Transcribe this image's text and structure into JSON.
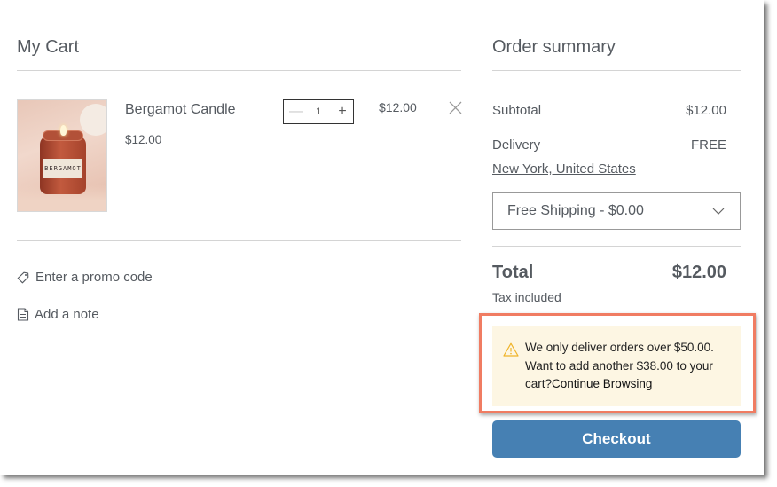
{
  "cart": {
    "title": "My Cart",
    "items": [
      {
        "name": "Bergamot Candle",
        "unit_price": "$12.00",
        "quantity": "1",
        "line_total": "$12.00",
        "image_label": "BERGAMOT",
        "image_icon": "candle-photo"
      }
    ],
    "promo_label": "Enter a promo code",
    "promo_icon": "tag-icon",
    "note_label": "Add a note",
    "note_icon": "note-icon"
  },
  "summary": {
    "title": "Order summary",
    "subtotal_label": "Subtotal",
    "subtotal_value": "$12.00",
    "delivery_label": "Delivery",
    "delivery_value": "FREE",
    "location": "New York, United States",
    "shipping_option": "Free Shipping - $0.00",
    "total_label": "Total",
    "total_value": "$12.00",
    "tax_note": "Tax included",
    "notice": {
      "icon": "warning-icon",
      "line1": "We only deliver orders over $50.00.",
      "line2": "Want to add another $38.00 to your",
      "line3_prefix": "cart?",
      "link": "Continue Browsing"
    },
    "checkout_label": "Checkout"
  },
  "colors": {
    "accent": "#4680b3",
    "notice_bg": "#fdf6e3",
    "highlight": "#f07c62",
    "warning": "#f0b429"
  }
}
